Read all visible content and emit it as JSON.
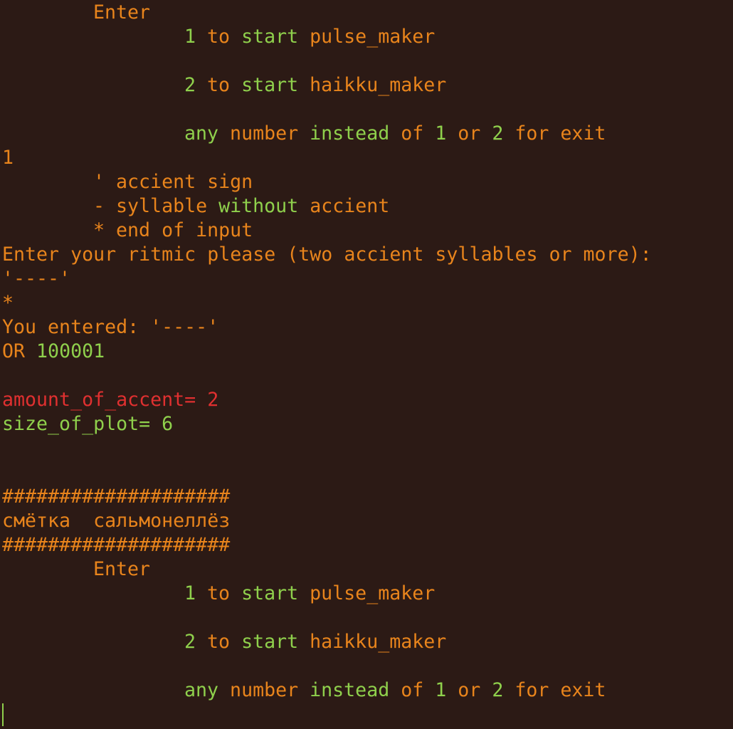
{
  "colors": {
    "background": "#2c1a15",
    "orange": "#e8841c",
    "green": "#8fd04c",
    "red": "#e03030"
  },
  "menu1": {
    "enter": "Enter",
    "opt1_num": "1",
    "opt1_a": " to ",
    "opt1_b": "start",
    "opt1_c": " pulse_maker",
    "opt2_num": "2",
    "opt2_a": " to ",
    "opt2_b": "start",
    "opt2_c": " haikku_maker",
    "exit_a": "any",
    "exit_b": " number ",
    "exit_c": "instead",
    "exit_d": " of ",
    "exit_e": "1",
    "exit_f": " or ",
    "exit_g": "2",
    "exit_h": " for exit"
  },
  "input_choice": "1",
  "legend": {
    "accent_a": "' accient ",
    "accent_b": "sign",
    "syllable_a": "- syllable ",
    "syllable_b": "without",
    "syllable_c": " accient",
    "end_a": "* ",
    "end_b": "end",
    "end_c": " of input"
  },
  "prompt": "Enter your ritmic please (two accient syllables or more):",
  "input_ritmic": "'----'",
  "input_end": "*",
  "entered": "You entered: '----'",
  "or_label": "OR ",
  "or_value": "100001",
  "accent_count": "amount_of_accent= 2",
  "plot_label": "size_of_plot= ",
  "plot_value": "6",
  "separator": "####################",
  "result": "смётка  сальмонеллёз",
  "menu2": {
    "enter": "Enter",
    "opt1_num": "1",
    "opt1_a": " to ",
    "opt1_b": "start",
    "opt1_c": " pulse_maker",
    "opt2_num": "2",
    "opt2_a": " to ",
    "opt2_b": "start",
    "opt2_c": " haikku_maker",
    "exit_a": "any",
    "exit_b": " number ",
    "exit_c": "instead",
    "exit_d": " of ",
    "exit_e": "1",
    "exit_f": " or ",
    "exit_g": "2",
    "exit_h": " for exit"
  }
}
